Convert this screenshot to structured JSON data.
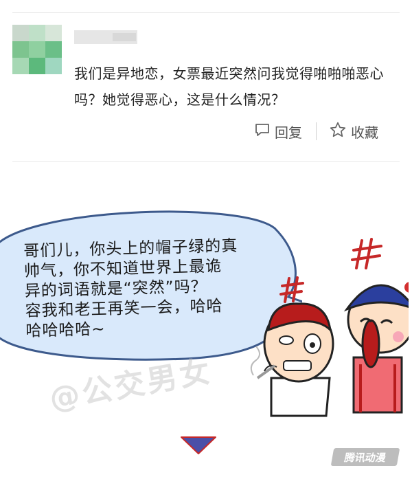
{
  "post": {
    "question": "我们是异地恋，女票最近突然问我觉得啪啪啪恶心吗？她觉得恶心，这是什么情况？",
    "reply_label": "回复",
    "favorite_label": "收藏",
    "reply_icon": "speech-bubble-icon",
    "favorite_icon": "star-icon"
  },
  "comic": {
    "speech": "哥们儿，你头上的帽子绿的真\n帅气，你不知道世界上最诡\n异的词语就是“突然”吗？\n容我和老王再笑一会，哈哈\n哈哈哈哈~",
    "watermark": "@公交男女",
    "logo": "腾讯动漫",
    "colors": {
      "bubble_fill": "#d9e9fb",
      "bubble_stroke": "#3d5a8c",
      "arrow": "#4a4fa8"
    }
  }
}
